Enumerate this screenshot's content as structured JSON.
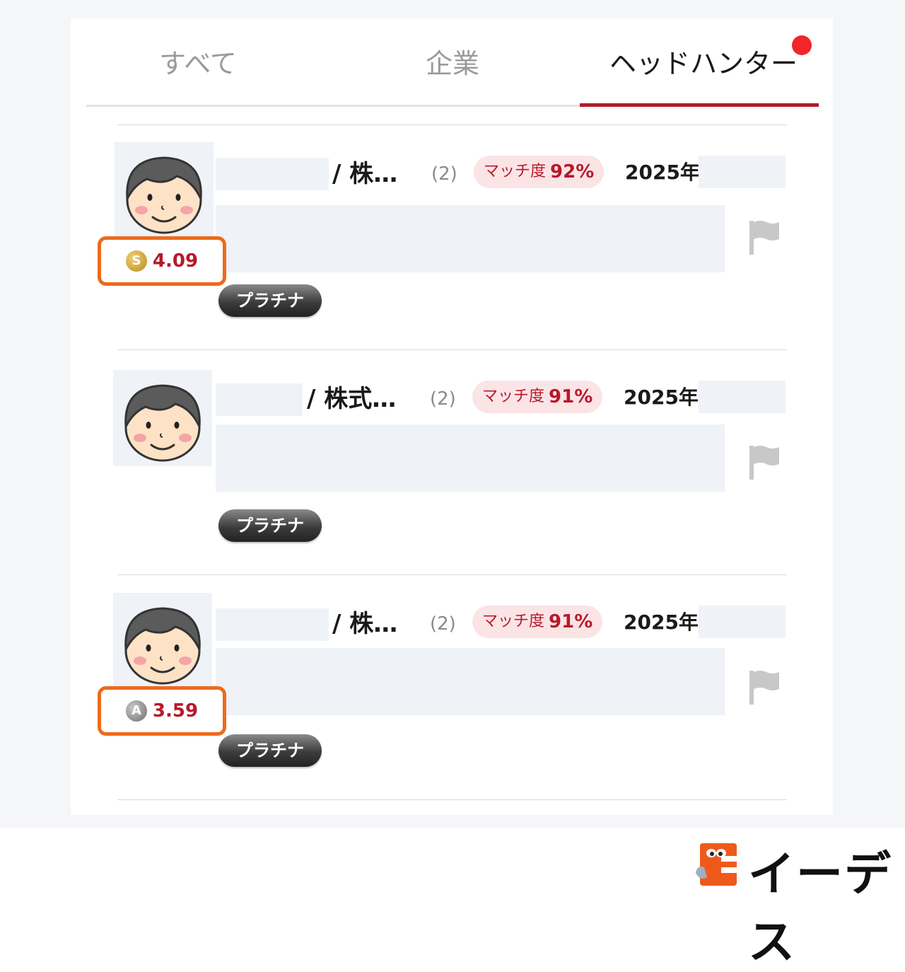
{
  "tabs": [
    {
      "label": "すべて"
    },
    {
      "label": "企業"
    },
    {
      "label": "ヘッドハンター"
    }
  ],
  "cards": [
    {
      "company": "/ 株…",
      "count": "(2)",
      "match_label": "マッチ度",
      "match_value": "92%",
      "year": "2025年",
      "badge": "プラチナ",
      "rank": "S",
      "rating": "4.09"
    },
    {
      "company": "/ 株式…",
      "count": "(2)",
      "match_label": "マッチ度",
      "match_value": "91%",
      "year": "2025年",
      "badge": "プラチナ"
    },
    {
      "company": "/ 株…",
      "count": "(2)",
      "match_label": "マッチ度",
      "match_value": "91%",
      "year": "2025年",
      "badge": "プラチナ",
      "rank": "A",
      "rating": "3.59"
    }
  ],
  "logo": {
    "text": "イーデス"
  },
  "colors": {
    "accent": "#b61a2a",
    "highlight": "#ee6a1c",
    "notification": "#f0262a"
  }
}
